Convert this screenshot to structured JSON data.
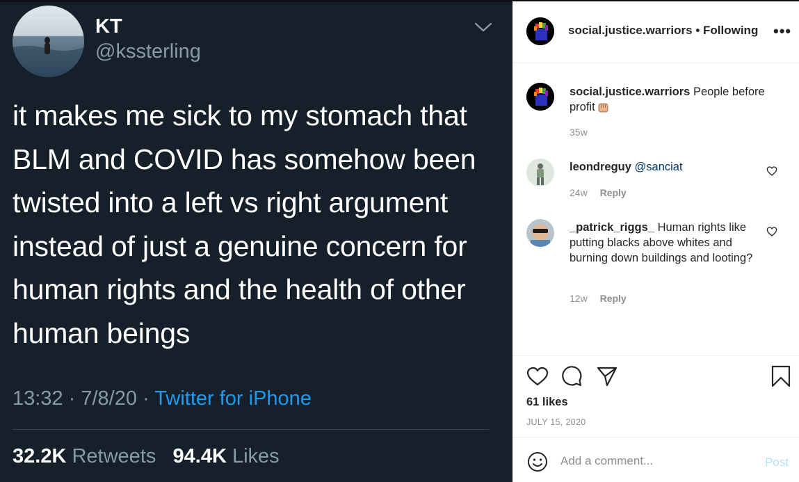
{
  "tweet": {
    "display_name": "KT",
    "handle": "@kssterling",
    "text": "it makes me sick to my stomach that BLM and COVID has somehow been twisted into a left vs right argument instead of just a genuine concern for human rights and the health of other human beings",
    "time": "13:32",
    "date": "7/8/20",
    "source": "Twitter for iPhone",
    "retweets_count": "32.2K",
    "retweets_label": "Retweets",
    "likes_count": "94.4K",
    "likes_label": "Likes"
  },
  "post": {
    "username": "social.justice.warriors",
    "follow_state": "Following",
    "caption": {
      "username": "social.justice.warriors",
      "text": "People before profit",
      "time": "35w"
    },
    "comments": [
      {
        "username": "leondreguy",
        "text": "@sanciat",
        "time": "24w",
        "reply_label": "Reply"
      },
      {
        "username": "_patrick_riggs_",
        "text": "Human rights like putting blacks above whites and burning down buildings and looting?",
        "time": "12w",
        "reply_label": "Reply"
      }
    ],
    "likes_text": "61 likes",
    "date": "JULY 15, 2020",
    "add_comment_placeholder": "Add a comment...",
    "post_button": "Post"
  },
  "colors": {
    "tweet_bg": "#15202b",
    "tweet_muted": "#8b98a5",
    "tweet_link": "#1d9bf0",
    "ig_text": "#262626",
    "ig_muted": "#8e8e8e",
    "ig_post_disabled": "#b2dffc",
    "ig_mention": "#00376b"
  },
  "icons": [
    "chevron-down-icon",
    "more-icon",
    "heart-icon",
    "comment-icon",
    "share-icon",
    "bookmark-icon",
    "emoji-icon",
    "raised-fist-emoji"
  ]
}
